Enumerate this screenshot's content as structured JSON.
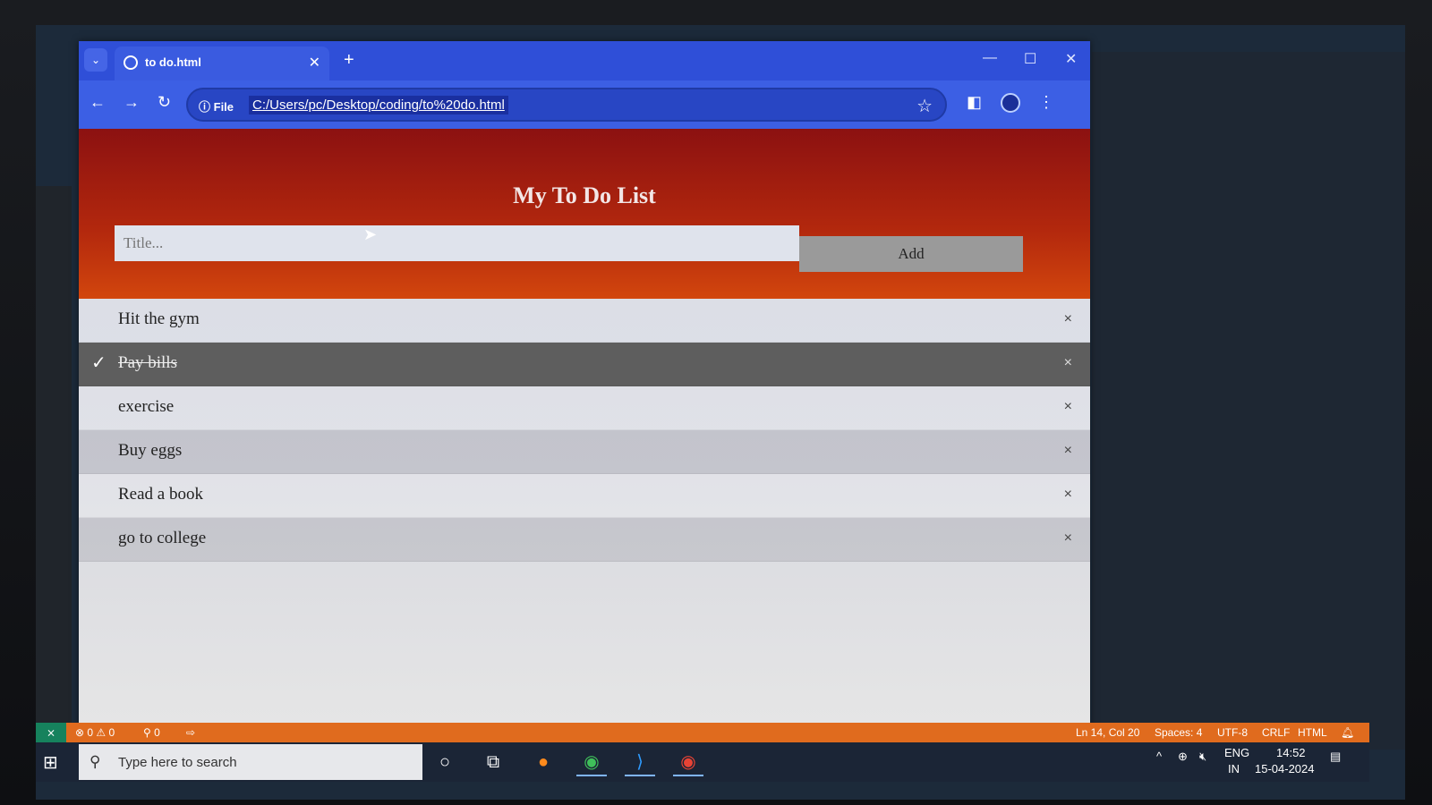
{
  "browser": {
    "tab_title": "to do.html",
    "new_tab_label": "+",
    "info_label": "File",
    "url": "C:/Users/pc/Desktop/coding/to%20do.html"
  },
  "todo": {
    "title": "My To Do List",
    "input_placeholder": "Title...",
    "add_label": "Add",
    "items": [
      {
        "text": "Hit the gym",
        "checked": false
      },
      {
        "text": "Pay bills",
        "checked": true
      },
      {
        "text": "exercise",
        "checked": false
      },
      {
        "text": "Buy eggs",
        "checked": false
      },
      {
        "text": "Read a book",
        "checked": false
      },
      {
        "text": "go to college",
        "checked": false
      }
    ],
    "close_symbol": "×"
  },
  "statusbar": {
    "problems": "⊗ 0 ⚠ 0",
    "ports": "⚲ 0",
    "position": "Ln 14, Col 20",
    "spaces": "Spaces: 4",
    "encoding": "UTF-8",
    "eol": "CRLF",
    "language": "HTML"
  },
  "taskbar": {
    "search_placeholder": "Type here to search",
    "lang": "ENG",
    "region": "IN",
    "time": "14:52",
    "date": "15-04-2024"
  },
  "colors": {
    "header_top": "#8c1111",
    "header_bottom": "#d2460d",
    "checked_row": "#5e5e5e",
    "browser_accent": "#3c5fe4"
  }
}
